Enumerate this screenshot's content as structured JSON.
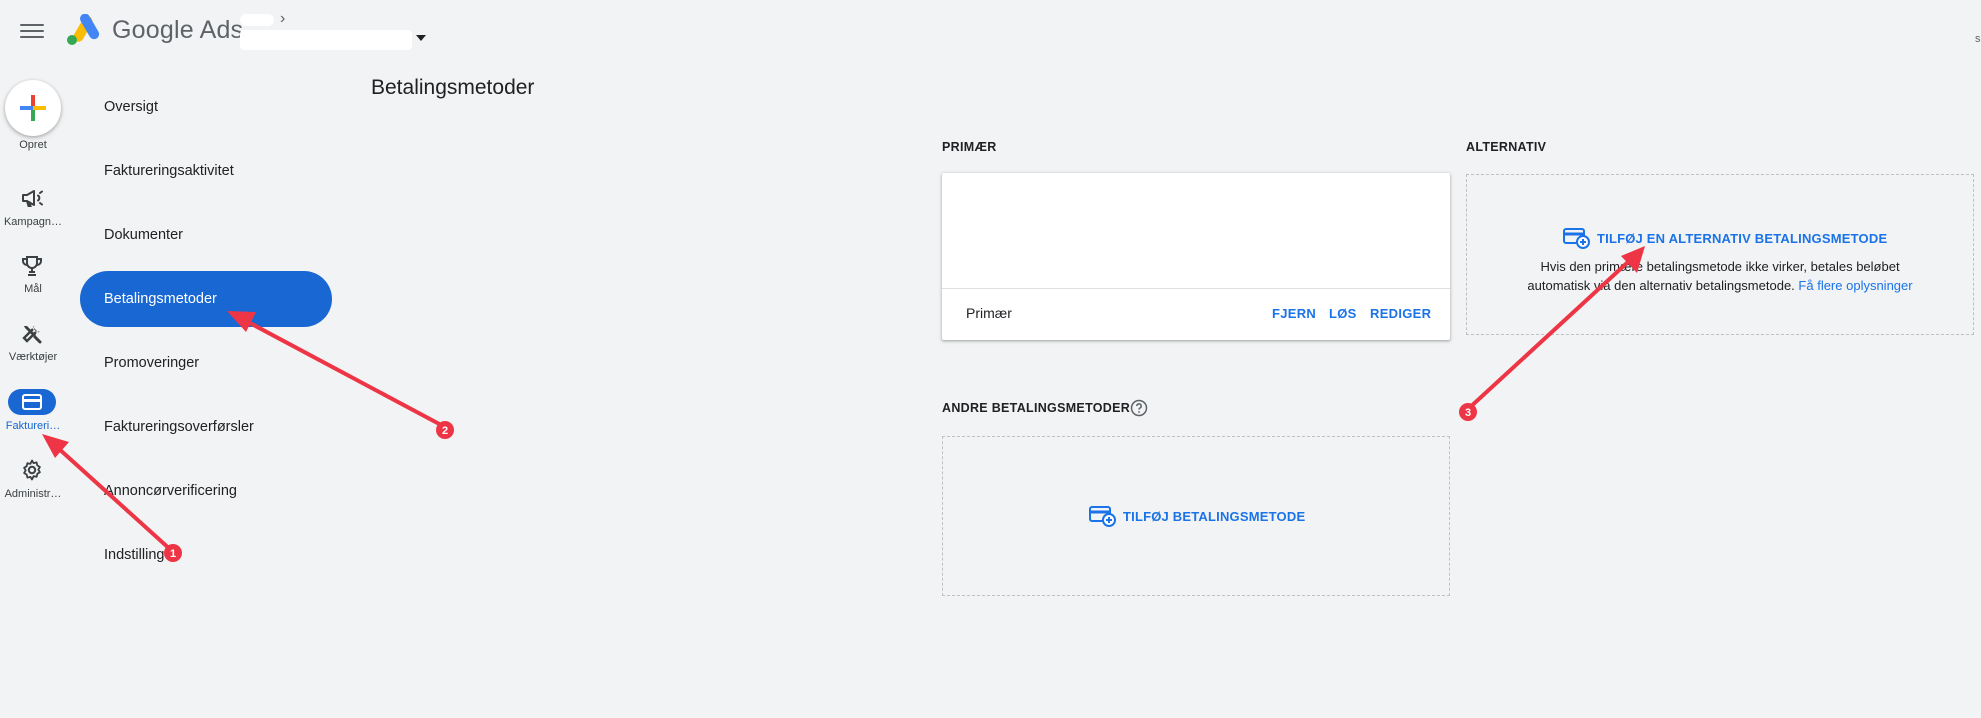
{
  "header": {
    "app_name": "Google Ads",
    "menu_icon": "hamburger-menu-icon",
    "account_chevron": "›",
    "edge_text": "s"
  },
  "rail": {
    "create_label": "Opret",
    "items": [
      {
        "label": "Kampagn…",
        "icon": "megaphone-icon"
      },
      {
        "label": "Mål",
        "icon": "trophy-icon"
      },
      {
        "label": "Værktøjer",
        "icon": "tools-icon"
      },
      {
        "label": "Faktureri…",
        "icon": "credit-card-icon",
        "active": true
      },
      {
        "label": "Administr…",
        "icon": "gear-icon"
      }
    ]
  },
  "nav": {
    "items": [
      {
        "label": "Oversigt"
      },
      {
        "label": "Faktureringsaktivitet"
      },
      {
        "label": "Dokumenter"
      },
      {
        "label": "Betalingsmetoder",
        "active": true
      },
      {
        "label": "Promoveringer"
      },
      {
        "label": "Faktureringsoverførsler"
      },
      {
        "label": "Annoncørverificering"
      },
      {
        "label": "Indstillinger"
      }
    ]
  },
  "page": {
    "title": "Betalingsmetoder"
  },
  "primary": {
    "section_label": "PRIMÆR",
    "card_label": "Primær",
    "actions": {
      "remove": "FJERN",
      "resolve": "LØS",
      "edit": "REDIGER"
    }
  },
  "alternative": {
    "section_label": "ALTERNATIV",
    "add_label": "TILFØJ EN ALTERNATIV BETALINGSMETODE",
    "description_line1": "Hvis den primære betalingsmetode ikke virker, betales beløbet",
    "description_line2": "automatisk via den alternativ betalingsmetode.",
    "learn_more": "Få flere oplysninger"
  },
  "other": {
    "section_label": "ANDRE BETALINGSMETODER",
    "add_label": "TILFØJ BETALINGSMETODE"
  },
  "annotations": {
    "badges": [
      "1",
      "2",
      "3"
    ]
  },
  "colors": {
    "background": "#f1f3f4",
    "accent": "#1967d2",
    "link": "#1a73e8",
    "annotation": "#ee3545"
  }
}
